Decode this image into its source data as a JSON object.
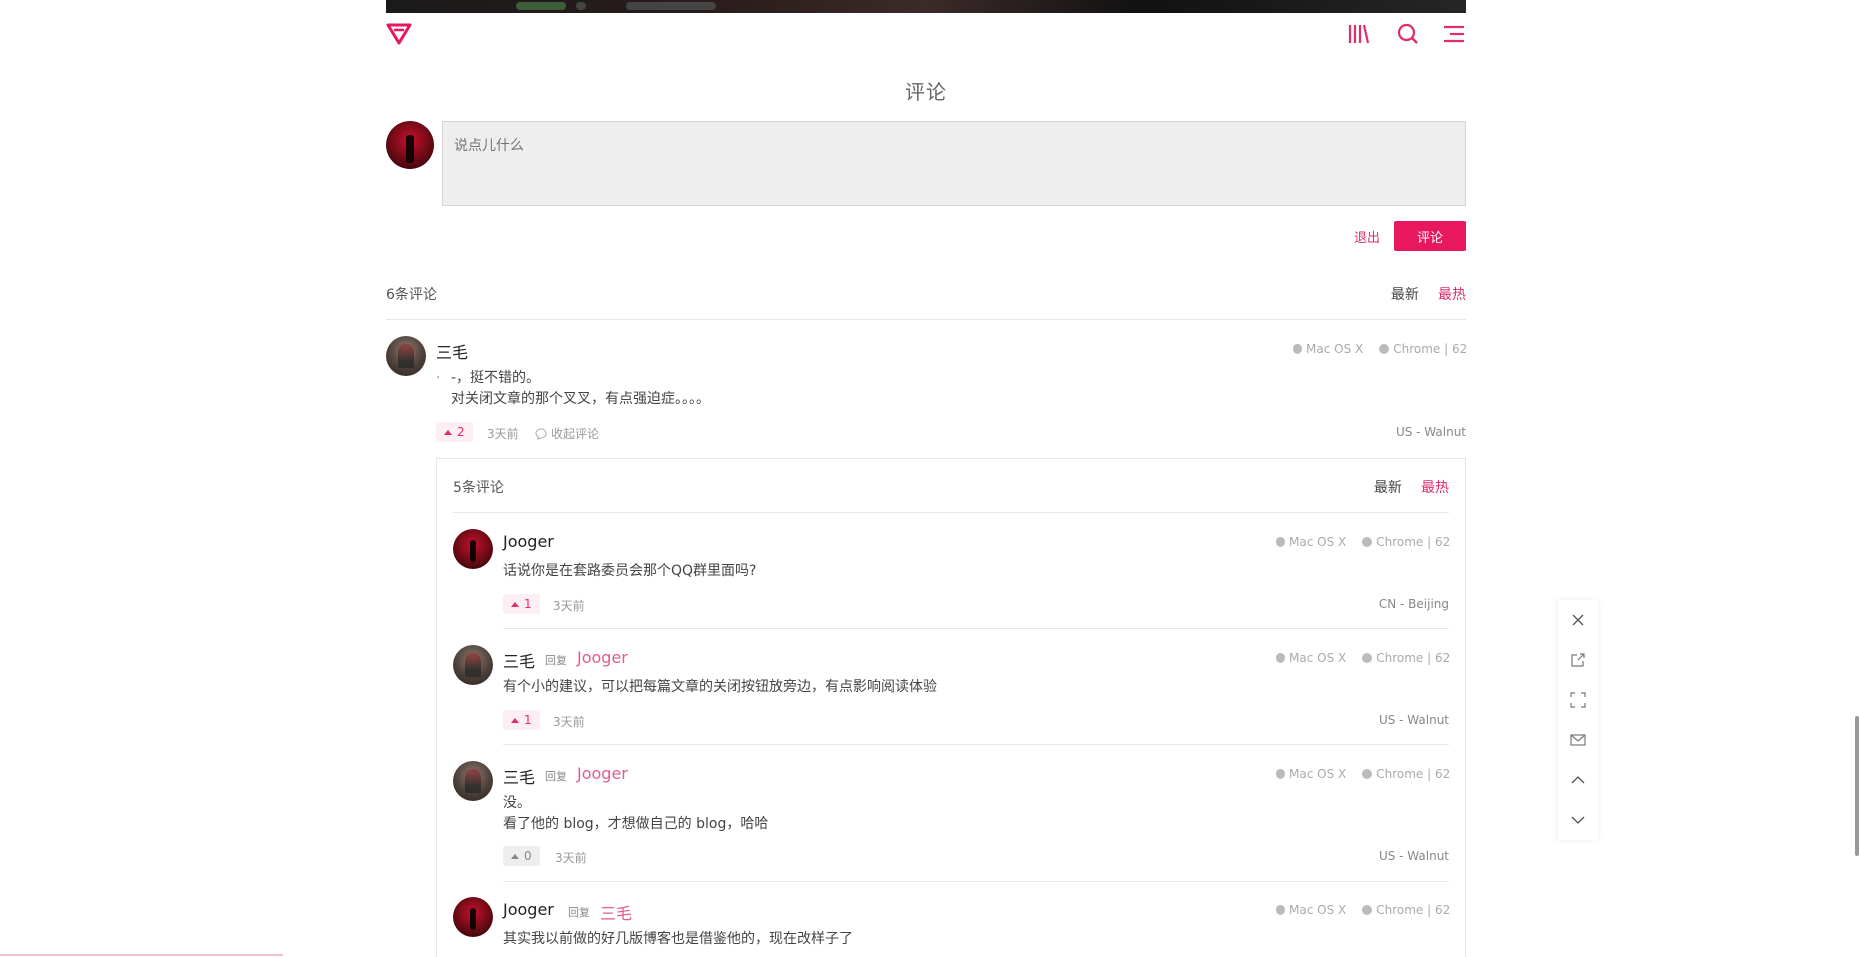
{
  "header": {
    "logo": "heart-diamond-logo"
  },
  "nav": {
    "icons": [
      "library-icon",
      "search-icon",
      "menu-icon"
    ]
  },
  "comments_section": {
    "title": "评论",
    "input_placeholder": "说点儿什么",
    "logout_label": "退出",
    "submit_label": "评论",
    "count_label": "6条评论",
    "sort_newest": "最新",
    "sort_hottest": "最热"
  },
  "colors": {
    "accent": "#e8185e",
    "reply_name": "#e25c8e"
  },
  "top_comment": {
    "author": "三毛",
    "os": "Mac OS X",
    "browser": "Chrome | 62",
    "bullet": "·",
    "lines": [
      "-，挺不错的。",
      "对关闭文章的那个叉叉，有点强迫症。。。。"
    ],
    "likes": "2",
    "time": "3天前",
    "collapse_label": "收起评论",
    "location": "US - Walnut"
  },
  "child_section": {
    "count_label": "5条评论",
    "sort_newest": "最新",
    "sort_hottest": "最热"
  },
  "replies": [
    {
      "author": "Jooger",
      "os": "Mac OS X",
      "browser": "Chrome | 62",
      "text": "话说你是在套路委员会那个QQ群里面吗?",
      "likes": "1",
      "time": "3天前",
      "location": "CN - Beijing"
    },
    {
      "author": "三毛",
      "reply_tag": "回复",
      "reply_to": "Jooger",
      "os": "Mac OS X",
      "browser": "Chrome | 62",
      "text": "有个小的建议，可以把每篇文章的关闭按钮放旁边，有点影响阅读体验",
      "likes": "1",
      "time": "3天前",
      "location": "US - Walnut"
    },
    {
      "author": "三毛",
      "reply_tag": "回复",
      "reply_to": "Jooger",
      "os": "Mac OS X",
      "browser": "Chrome | 62",
      "text_line1": "没。",
      "text_line2": "看了他的 blog，才想做自己的 blog，哈哈",
      "likes": "0",
      "time": "3天前",
      "location": "US - Walnut"
    },
    {
      "author": "Jooger",
      "reply_tag": "回复",
      "reply_to": "三毛",
      "os": "Mac OS X",
      "browser": "Chrome | 62",
      "text": "其实我以前做的好几版博客也是借鉴他的，现在改样子了"
    }
  ],
  "float_panel": [
    "close-icon",
    "share-icon",
    "fullscreen-icon",
    "mail-icon",
    "arrow-up-icon",
    "arrow-down-icon"
  ]
}
